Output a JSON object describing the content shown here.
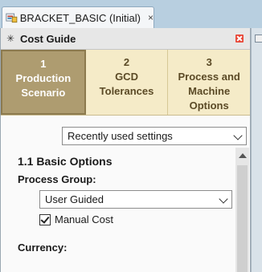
{
  "document_tab": {
    "title": "BRACKET_BASIC (Initial)",
    "close_glyph": "×"
  },
  "panel": {
    "title": "Cost Guide",
    "header_icon": "✳"
  },
  "steps": [
    {
      "num": "1",
      "label_line1": "Production",
      "label_line2": "Scenario",
      "label_line3": ""
    },
    {
      "num": "2",
      "label_line1": "GCD",
      "label_line2": "Tolerances",
      "label_line3": ""
    },
    {
      "num": "3",
      "label_line1": "Process and",
      "label_line2": "Machine",
      "label_line3": "Options"
    }
  ],
  "settings_dropdown": {
    "value": "Recently used settings"
  },
  "basic_options": {
    "title": "1.1 Basic Options",
    "process_group_label": "Process Group:",
    "process_group_value": "User Guided",
    "manual_cost_label": "Manual Cost",
    "manual_cost_checked": true,
    "currency_label": "Currency:"
  },
  "colors": {
    "active_step": "#ae9c70",
    "steps_bg": "#f5ebc8",
    "close_button": "#e84a3a"
  }
}
